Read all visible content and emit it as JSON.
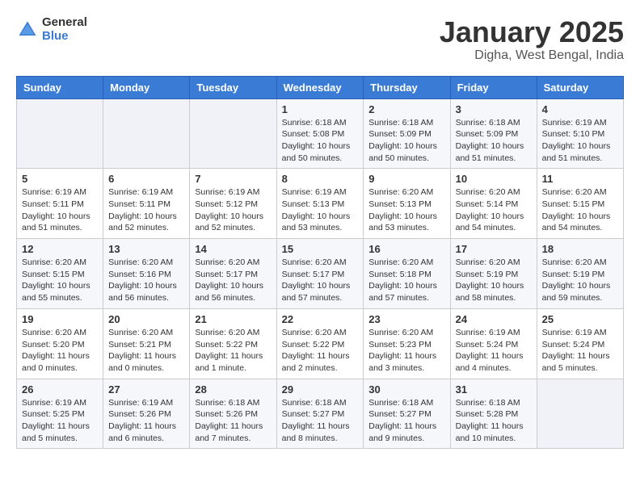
{
  "logo": {
    "general": "General",
    "blue": "Blue"
  },
  "title": "January 2025",
  "subtitle": "Digha, West Bengal, India",
  "days_of_week": [
    "Sunday",
    "Monday",
    "Tuesday",
    "Wednesday",
    "Thursday",
    "Friday",
    "Saturday"
  ],
  "weeks": [
    [
      {
        "day": "",
        "info": ""
      },
      {
        "day": "",
        "info": ""
      },
      {
        "day": "",
        "info": ""
      },
      {
        "day": "1",
        "info": "Sunrise: 6:18 AM\nSunset: 5:08 PM\nDaylight: 10 hours\nand 50 minutes."
      },
      {
        "day": "2",
        "info": "Sunrise: 6:18 AM\nSunset: 5:09 PM\nDaylight: 10 hours\nand 50 minutes."
      },
      {
        "day": "3",
        "info": "Sunrise: 6:18 AM\nSunset: 5:09 PM\nDaylight: 10 hours\nand 51 minutes."
      },
      {
        "day": "4",
        "info": "Sunrise: 6:19 AM\nSunset: 5:10 PM\nDaylight: 10 hours\nand 51 minutes."
      }
    ],
    [
      {
        "day": "5",
        "info": "Sunrise: 6:19 AM\nSunset: 5:11 PM\nDaylight: 10 hours\nand 51 minutes."
      },
      {
        "day": "6",
        "info": "Sunrise: 6:19 AM\nSunset: 5:11 PM\nDaylight: 10 hours\nand 52 minutes."
      },
      {
        "day": "7",
        "info": "Sunrise: 6:19 AM\nSunset: 5:12 PM\nDaylight: 10 hours\nand 52 minutes."
      },
      {
        "day": "8",
        "info": "Sunrise: 6:19 AM\nSunset: 5:13 PM\nDaylight: 10 hours\nand 53 minutes."
      },
      {
        "day": "9",
        "info": "Sunrise: 6:20 AM\nSunset: 5:13 PM\nDaylight: 10 hours\nand 53 minutes."
      },
      {
        "day": "10",
        "info": "Sunrise: 6:20 AM\nSunset: 5:14 PM\nDaylight: 10 hours\nand 54 minutes."
      },
      {
        "day": "11",
        "info": "Sunrise: 6:20 AM\nSunset: 5:15 PM\nDaylight: 10 hours\nand 54 minutes."
      }
    ],
    [
      {
        "day": "12",
        "info": "Sunrise: 6:20 AM\nSunset: 5:15 PM\nDaylight: 10 hours\nand 55 minutes."
      },
      {
        "day": "13",
        "info": "Sunrise: 6:20 AM\nSunset: 5:16 PM\nDaylight: 10 hours\nand 56 minutes."
      },
      {
        "day": "14",
        "info": "Sunrise: 6:20 AM\nSunset: 5:17 PM\nDaylight: 10 hours\nand 56 minutes."
      },
      {
        "day": "15",
        "info": "Sunrise: 6:20 AM\nSunset: 5:17 PM\nDaylight: 10 hours\nand 57 minutes."
      },
      {
        "day": "16",
        "info": "Sunrise: 6:20 AM\nSunset: 5:18 PM\nDaylight: 10 hours\nand 57 minutes."
      },
      {
        "day": "17",
        "info": "Sunrise: 6:20 AM\nSunset: 5:19 PM\nDaylight: 10 hours\nand 58 minutes."
      },
      {
        "day": "18",
        "info": "Sunrise: 6:20 AM\nSunset: 5:19 PM\nDaylight: 10 hours\nand 59 minutes."
      }
    ],
    [
      {
        "day": "19",
        "info": "Sunrise: 6:20 AM\nSunset: 5:20 PM\nDaylight: 11 hours\nand 0 minutes."
      },
      {
        "day": "20",
        "info": "Sunrise: 6:20 AM\nSunset: 5:21 PM\nDaylight: 11 hours\nand 0 minutes."
      },
      {
        "day": "21",
        "info": "Sunrise: 6:20 AM\nSunset: 5:22 PM\nDaylight: 11 hours\nand 1 minute."
      },
      {
        "day": "22",
        "info": "Sunrise: 6:20 AM\nSunset: 5:22 PM\nDaylight: 11 hours\nand 2 minutes."
      },
      {
        "day": "23",
        "info": "Sunrise: 6:20 AM\nSunset: 5:23 PM\nDaylight: 11 hours\nand 3 minutes."
      },
      {
        "day": "24",
        "info": "Sunrise: 6:19 AM\nSunset: 5:24 PM\nDaylight: 11 hours\nand 4 minutes."
      },
      {
        "day": "25",
        "info": "Sunrise: 6:19 AM\nSunset: 5:24 PM\nDaylight: 11 hours\nand 5 minutes."
      }
    ],
    [
      {
        "day": "26",
        "info": "Sunrise: 6:19 AM\nSunset: 5:25 PM\nDaylight: 11 hours\nand 5 minutes."
      },
      {
        "day": "27",
        "info": "Sunrise: 6:19 AM\nSunset: 5:26 PM\nDaylight: 11 hours\nand 6 minutes."
      },
      {
        "day": "28",
        "info": "Sunrise: 6:18 AM\nSunset: 5:26 PM\nDaylight: 11 hours\nand 7 minutes."
      },
      {
        "day": "29",
        "info": "Sunrise: 6:18 AM\nSunset: 5:27 PM\nDaylight: 11 hours\nand 8 minutes."
      },
      {
        "day": "30",
        "info": "Sunrise: 6:18 AM\nSunset: 5:27 PM\nDaylight: 11 hours\nand 9 minutes."
      },
      {
        "day": "31",
        "info": "Sunrise: 6:18 AM\nSunset: 5:28 PM\nDaylight: 11 hours\nand 10 minutes."
      },
      {
        "day": "",
        "info": ""
      }
    ]
  ]
}
